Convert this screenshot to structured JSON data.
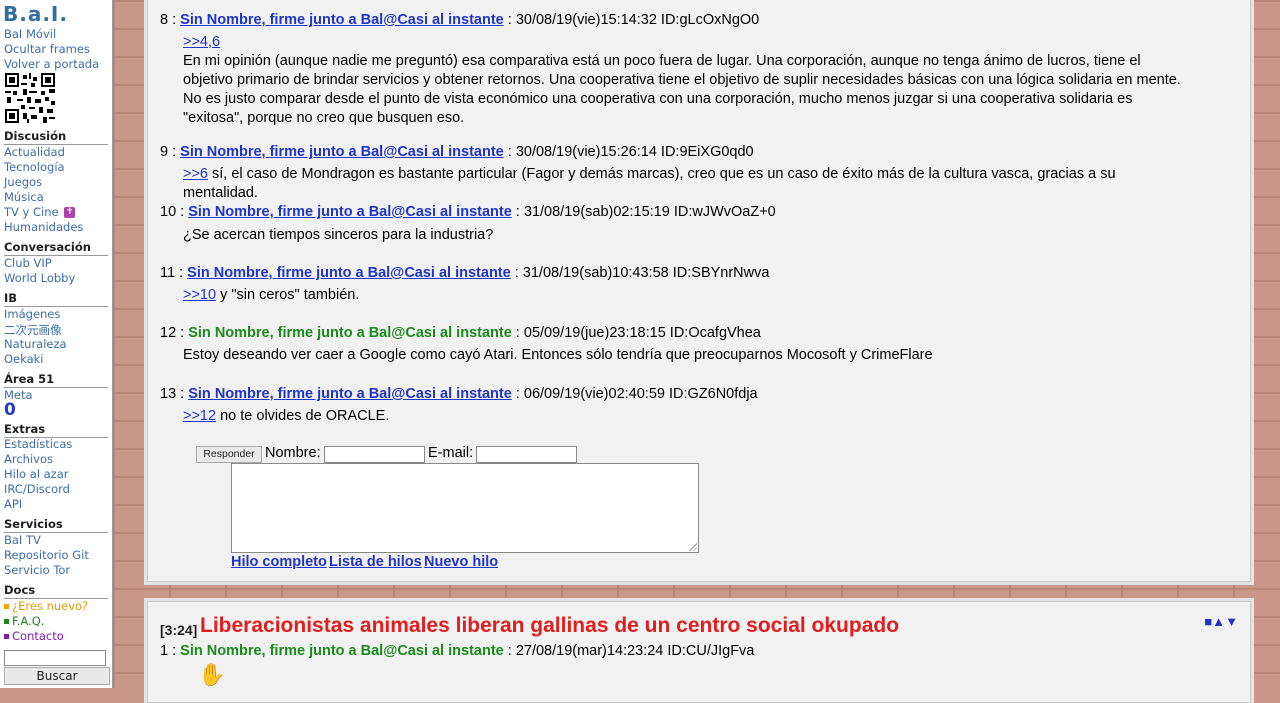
{
  "sidebar": {
    "logo": "B.a.I.",
    "top_links": [
      "BaI Móvil",
      "Ocultar frames",
      "Volver a portada"
    ],
    "sections": [
      {
        "title": "Discusión",
        "items": [
          "Actualidad",
          "Tecnología",
          "Juegos",
          "Música",
          "TV y Cine",
          "Humanidades"
        ]
      },
      {
        "title": "Conversación",
        "items": [
          "Club VIP",
          "World Lobby"
        ]
      },
      {
        "title": "IB",
        "items": [
          "Imágenes",
          "二次元画像",
          "Naturaleza",
          "Oekaki"
        ]
      },
      {
        "title": "Área 51",
        "items": [
          "Meta"
        ]
      },
      {
        "title": "Extras",
        "items": [
          "Estadísticas",
          "Archivos",
          "Hilo al azar",
          "IRC/Discord",
          "API"
        ]
      },
      {
        "title": "Servicios",
        "items": [
          "BaI TV",
          "Repositorio Git",
          "Servicio Tor"
        ]
      },
      {
        "title": "Docs",
        "items": [
          "¿Eres nuevo?",
          "F.A.Q.",
          "Contacto"
        ]
      }
    ],
    "meta_count": "0",
    "tv_badge_icon": "cross-badge-icon",
    "docs_colors": [
      "#f0a800",
      "#1b8a1b",
      "#7a1fb0"
    ],
    "search_button": "Buscar"
  },
  "thread1": {
    "posts": [
      {
        "num": "8",
        "name": "Sin Nombre, firme junto a Bal@Casi al instante",
        "linked": true,
        "date": "30/08/19(vie)15:14:32 ID:gLcOxNgO0",
        "ref": ">>4,6",
        "text": "En mi opinión (aunque nadie me preguntó) esa comparativa está un poco fuera de lugar. Una corporación, aunque no tenga ánimo de lucros, tiene el objetivo primario de brindar servicios y obtener retornos. Una cooperativa tiene el objetivo de suplir necesidades básicas con una lógica solidaria en mente. No es justo comparar desde el punto de vista económico una cooperativa con una corporación, mucho menos juzgar si una cooperativa solidaria es \"exitosa\", porque no creo que busquen eso."
      },
      {
        "num": "9",
        "name": "Sin Nombre, firme junto a Bal@Casi al instante",
        "linked": true,
        "date": "30/08/19(vie)15:26:14 ID:9EiXG0qd0",
        "ref": ">>6",
        "text": "sí, el caso de Mondragon es bastante particular (Fagor y demás marcas), creo que es un caso de éxito más de la cultura vasca, gracias a su mentalidad."
      },
      {
        "num": "10",
        "name": "Sin Nombre, firme junto a Bal@Casi al instante",
        "linked": true,
        "date": "31/08/19(sab)02:15:19 ID:wJWvOaZ+0",
        "ref": "",
        "text": "¿Se acercan tiempos sinceros para la industria?"
      },
      {
        "num": "11",
        "name": "Sin Nombre, firme junto a Bal@Casi al instante",
        "linked": true,
        "date": "31/08/19(sab)10:43:58 ID:SBYnrNwva",
        "ref": ">>10",
        "text": "y \"sin ceros\" también."
      },
      {
        "num": "12",
        "name": "Sin Nombre, firme junto a Bal@Casi al instante",
        "linked": false,
        "date": "05/09/19(jue)23:18:15 ID:OcafgVhea",
        "ref": "",
        "text": "Estoy deseando ver caer a Google como cayó Atari. Entonces sólo tendría que preocuparnos Mocosoft y CrimeFlare"
      },
      {
        "num": "13",
        "name": "Sin Nombre, firme junto a Bal@Casi al instante",
        "linked": true,
        "date": "06/09/19(vie)02:40:59 ID:GZ6N0fdja",
        "ref": ">>12",
        "text": "no te olvides de ORACLE."
      }
    ],
    "form": {
      "reply_button": "Responder",
      "name_label": "Nombre:",
      "email_label": "E-mail:",
      "name_value": "",
      "email_value": "",
      "message_value": ""
    },
    "nav": [
      "Hilo completo",
      "Lista de hilos",
      "Nuevo hilo"
    ]
  },
  "thread2": {
    "number": "[3:24]",
    "title": "Liberacionistas animales liberan gallinas de un centro social okupado",
    "arrows": "■▲▼",
    "posts": [
      {
        "num": "1",
        "name": "Sin Nombre, firme junto a Bal@Casi al instante",
        "linked": false,
        "date": "27/08/19(mar)14:23:24 ID:CU/JIgFva"
      }
    ]
  }
}
